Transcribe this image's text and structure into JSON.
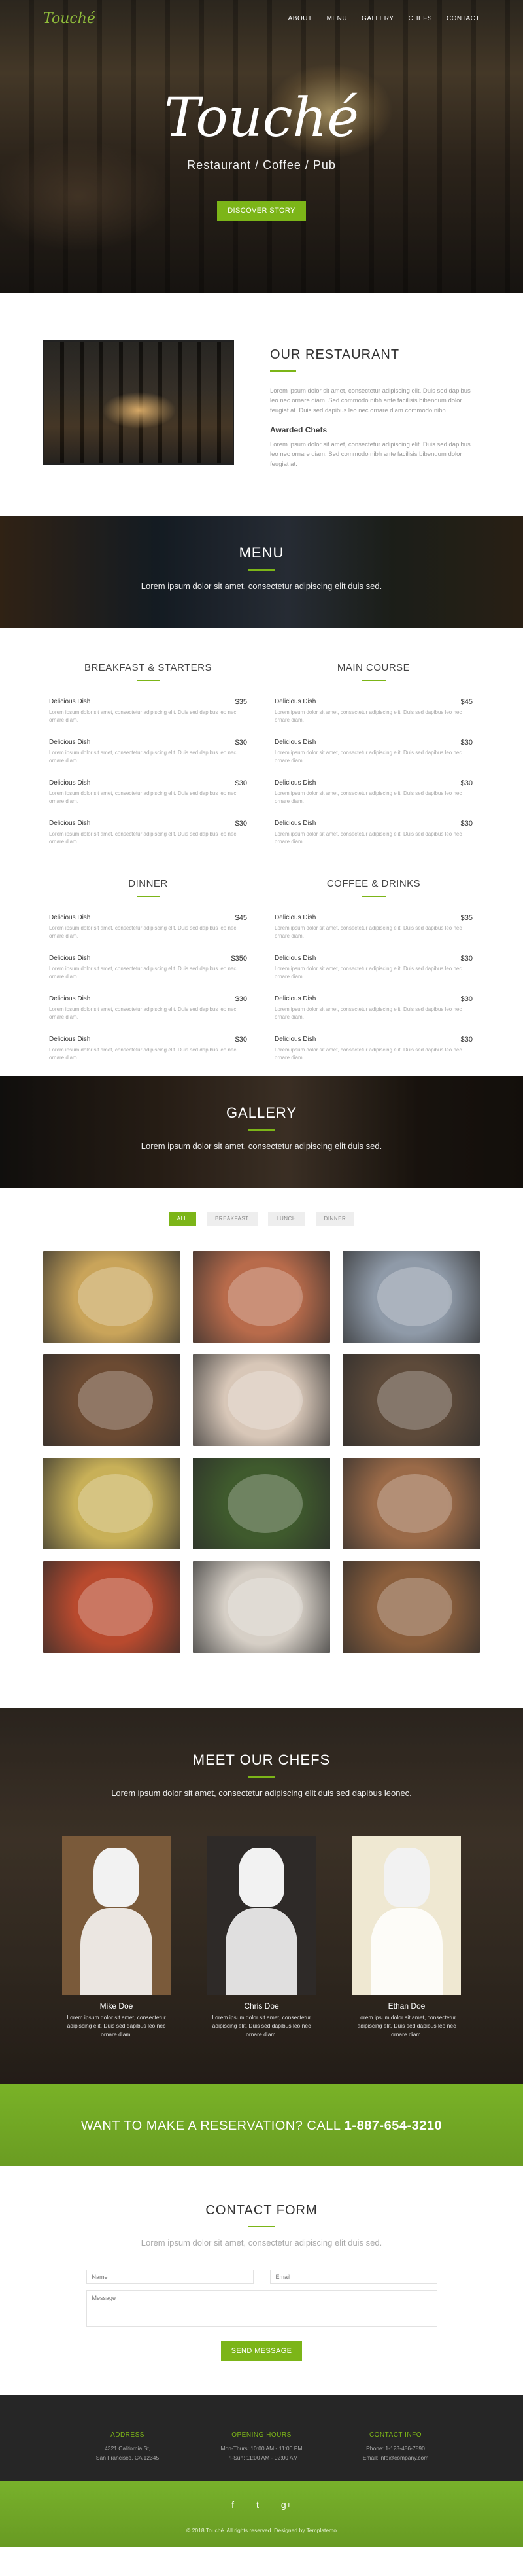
{
  "header": {
    "logo": "Touché",
    "nav": [
      "ABOUT",
      "MENU",
      "GALLERY",
      "CHEFS",
      "CONTACT"
    ]
  },
  "hero": {
    "title": "Touché",
    "subtitle": "Restaurant / Coffee / Pub",
    "button": "DISCOVER STORY"
  },
  "restaurant": {
    "title": "OUR RESTAURANT",
    "paragraph1": "Lorem ipsum dolor sit amet, consectetur adipiscing elit. Duis sed dapibus leo nec ornare diam. Sed commodo nibh ante facilisis bibendum dolor feugiat at. Duis sed dapibus leo nec ornare diam commodo nibh.",
    "subheading": "Awarded Chefs",
    "paragraph2": "Lorem ipsum dolor sit amet, consectetur adipiscing elit. Duis sed dapibus leo nec ornare diam. Sed commodo nibh ante facilisis bibendum dolor feugiat at."
  },
  "menu_banner": {
    "title": "MENU",
    "subtitle": "Lorem ipsum dolor sit amet, consectetur adipiscing elit duis sed."
  },
  "menu": {
    "item_desc": "Lorem ipsum dolor sit amet, consectetur adipiscing elit. Duis sed dapibus leo nec ornare diam.",
    "columns": [
      {
        "title": "BREAKFAST & STARTERS",
        "items": [
          {
            "name": "Delicious Dish",
            "price": "$35"
          },
          {
            "name": "Delicious Dish",
            "price": "$30"
          },
          {
            "name": "Delicious Dish",
            "price": "$30"
          },
          {
            "name": "Delicious Dish",
            "price": "$30"
          }
        ]
      },
      {
        "title": "MAIN COURSE",
        "items": [
          {
            "name": "Delicious Dish",
            "price": "$45"
          },
          {
            "name": "Delicious Dish",
            "price": "$30"
          },
          {
            "name": "Delicious Dish",
            "price": "$30"
          },
          {
            "name": "Delicious Dish",
            "price": "$30"
          }
        ]
      },
      {
        "title": "DINNER",
        "items": [
          {
            "name": "Delicious Dish",
            "price": "$45"
          },
          {
            "name": "Delicious Dish",
            "price": "$350"
          },
          {
            "name": "Delicious Dish",
            "price": "$30"
          },
          {
            "name": "Delicious Dish",
            "price": "$30"
          }
        ]
      },
      {
        "title": "COFFEE & DRINKS",
        "items": [
          {
            "name": "Delicious Dish",
            "price": "$35"
          },
          {
            "name": "Delicious Dish",
            "price": "$30"
          },
          {
            "name": "Delicious Dish",
            "price": "$30"
          },
          {
            "name": "Delicious Dish",
            "price": "$30"
          }
        ]
      }
    ]
  },
  "gallery_banner": {
    "title": "GALLERY",
    "subtitle": "Lorem ipsum dolor sit amet, consectetur adipiscing elit duis sed."
  },
  "gallery": {
    "filters": [
      "ALL",
      "BREAKFAST",
      "LUNCH",
      "DINNER"
    ],
    "active_filter": "ALL",
    "tile_colors": [
      "#c9a45a",
      "#b86b4b",
      "#8f9aa8",
      "#6b4a32",
      "#d8c7b8",
      "#5d4a3a",
      "#c8b058",
      "#3f5a2d",
      "#9a6a48",
      "#b84a2e",
      "#d6cfc6",
      "#8a5e3c"
    ]
  },
  "chefs": {
    "title": "MEET OUR CHEFS",
    "subtitle": "Lorem ipsum dolor sit amet, consectetur adipiscing elit duis sed dapibus leonec.",
    "desc": "Lorem ipsum dolor sit amet, consectetur adipiscing elit. Duis sed dapibus leo nec ornare diam.",
    "members": [
      {
        "name": "Mike Doe",
        "bg": "#7a5a3a"
      },
      {
        "name": "Chris Doe",
        "bg": "#2e2a28"
      },
      {
        "name": "Ethan Doe",
        "bg": "#efe8d2"
      }
    ]
  },
  "reservation": {
    "text": "WANT TO MAKE A RESERVATION? CALL ",
    "phone": "1-887-654-3210"
  },
  "contact": {
    "title": "CONTACT FORM",
    "subtitle": "Lorem ipsum dolor sit amet, consectetur adipiscing elit duis sed.",
    "name_placeholder": "Name",
    "email_placeholder": "Email",
    "message_placeholder": "Message",
    "send": "SEND MESSAGE"
  },
  "footer": {
    "address": {
      "title": "ADDRESS",
      "line1": "4321 California St,",
      "line2": "San Francisco, CA 12345"
    },
    "hours": {
      "title": "OPENING HOURS",
      "line1": "Mon-Thurs: 10:00 AM - 11:00 PM",
      "line2": "Fri-Sun: 11:00 AM - 02:00 AM"
    },
    "info": {
      "title": "CONTACT INFO",
      "line1": "Phone: 1-123-456-7890",
      "line2": "Email: info@company.com"
    },
    "social": [
      "f",
      "t",
      "g+"
    ],
    "copyright": "© 2018 Touché. All rights reserved. Designed by Templatemo"
  },
  "colors": {
    "accent": "#7cb518",
    "footer_bg": "#262626"
  }
}
